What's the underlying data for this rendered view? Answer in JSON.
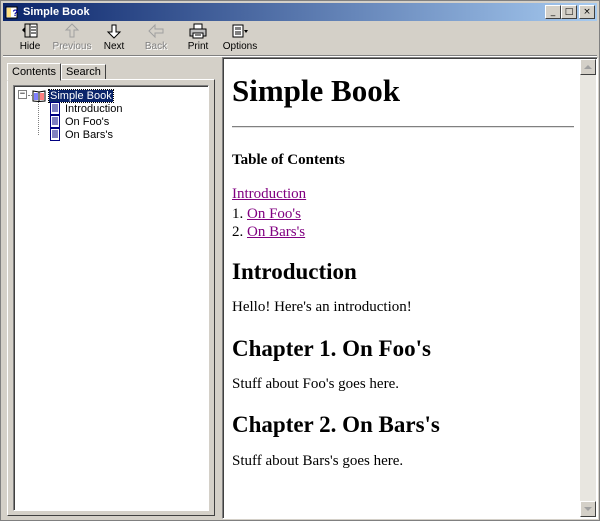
{
  "window": {
    "title": "Simple Book",
    "controls": {
      "minimize": "_",
      "maximize": "□",
      "close": "×"
    }
  },
  "toolbar": {
    "items": [
      {
        "label": "Hide",
        "icon": "hide-icon",
        "enabled": true
      },
      {
        "label": "Previous",
        "icon": "up-arrow-icon",
        "enabled": false
      },
      {
        "label": "Next",
        "icon": "down-arrow-icon",
        "enabled": true
      },
      {
        "label": "Back",
        "icon": "left-arrow-icon",
        "enabled": false
      },
      {
        "label": "Print",
        "icon": "printer-icon",
        "enabled": true
      },
      {
        "label": "Options",
        "icon": "options-icon",
        "enabled": true
      }
    ]
  },
  "sidebar": {
    "tabs": [
      {
        "label": "Contents",
        "active": true
      },
      {
        "label": "Search",
        "active": false
      }
    ],
    "tree": {
      "expander": "−",
      "root": {
        "label": "Simple Book",
        "icon": "open-book-icon",
        "selected": true
      },
      "children": [
        {
          "label": "Introduction",
          "icon": "page-icon"
        },
        {
          "label": "On Foo's",
          "icon": "page-icon"
        },
        {
          "label": "On Bars's",
          "icon": "page-icon"
        }
      ]
    }
  },
  "document": {
    "title": "Simple Book",
    "toc_heading": "Table of Contents",
    "toc": {
      "intro": "Introduction",
      "items": [
        {
          "number": "1.",
          "label": "On Foo's"
        },
        {
          "number": "2.",
          "label": "On Bars's"
        }
      ]
    },
    "sections": [
      {
        "heading": "Introduction",
        "body": "Hello! Here's an introduction!"
      },
      {
        "heading": "Chapter 1. On Foo's",
        "body": "Stuff about Foo's goes here."
      },
      {
        "heading": "Chapter 2. On Bars's",
        "body": "Stuff about Bars's goes here."
      }
    ]
  },
  "colors": {
    "title_bar_start": "#0a246a",
    "title_bar_end": "#a6caf0",
    "chrome": "#d4d0c8",
    "link_visited": "#800080",
    "selection": "#0a246a"
  }
}
